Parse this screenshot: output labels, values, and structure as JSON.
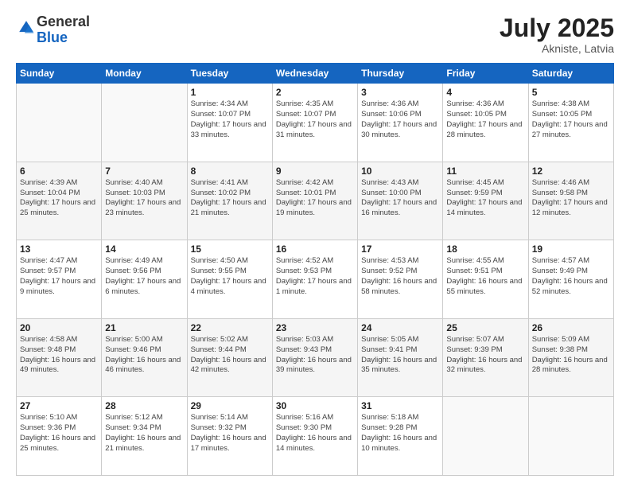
{
  "header": {
    "logo_general": "General",
    "logo_blue": "Blue",
    "month": "July 2025",
    "location": "Akniste, Latvia"
  },
  "days_of_week": [
    "Sunday",
    "Monday",
    "Tuesday",
    "Wednesday",
    "Thursday",
    "Friday",
    "Saturday"
  ],
  "weeks": [
    [
      {
        "day": "",
        "info": ""
      },
      {
        "day": "",
        "info": ""
      },
      {
        "day": "1",
        "info": "Sunrise: 4:34 AM\nSunset: 10:07 PM\nDaylight: 17 hours and 33 minutes."
      },
      {
        "day": "2",
        "info": "Sunrise: 4:35 AM\nSunset: 10:07 PM\nDaylight: 17 hours and 31 minutes."
      },
      {
        "day": "3",
        "info": "Sunrise: 4:36 AM\nSunset: 10:06 PM\nDaylight: 17 hours and 30 minutes."
      },
      {
        "day": "4",
        "info": "Sunrise: 4:36 AM\nSunset: 10:05 PM\nDaylight: 17 hours and 28 minutes."
      },
      {
        "day": "5",
        "info": "Sunrise: 4:38 AM\nSunset: 10:05 PM\nDaylight: 17 hours and 27 minutes."
      }
    ],
    [
      {
        "day": "6",
        "info": "Sunrise: 4:39 AM\nSunset: 10:04 PM\nDaylight: 17 hours and 25 minutes."
      },
      {
        "day": "7",
        "info": "Sunrise: 4:40 AM\nSunset: 10:03 PM\nDaylight: 17 hours and 23 minutes."
      },
      {
        "day": "8",
        "info": "Sunrise: 4:41 AM\nSunset: 10:02 PM\nDaylight: 17 hours and 21 minutes."
      },
      {
        "day": "9",
        "info": "Sunrise: 4:42 AM\nSunset: 10:01 PM\nDaylight: 17 hours and 19 minutes."
      },
      {
        "day": "10",
        "info": "Sunrise: 4:43 AM\nSunset: 10:00 PM\nDaylight: 17 hours and 16 minutes."
      },
      {
        "day": "11",
        "info": "Sunrise: 4:45 AM\nSunset: 9:59 PM\nDaylight: 17 hours and 14 minutes."
      },
      {
        "day": "12",
        "info": "Sunrise: 4:46 AM\nSunset: 9:58 PM\nDaylight: 17 hours and 12 minutes."
      }
    ],
    [
      {
        "day": "13",
        "info": "Sunrise: 4:47 AM\nSunset: 9:57 PM\nDaylight: 17 hours and 9 minutes."
      },
      {
        "day": "14",
        "info": "Sunrise: 4:49 AM\nSunset: 9:56 PM\nDaylight: 17 hours and 6 minutes."
      },
      {
        "day": "15",
        "info": "Sunrise: 4:50 AM\nSunset: 9:55 PM\nDaylight: 17 hours and 4 minutes."
      },
      {
        "day": "16",
        "info": "Sunrise: 4:52 AM\nSunset: 9:53 PM\nDaylight: 17 hours and 1 minute."
      },
      {
        "day": "17",
        "info": "Sunrise: 4:53 AM\nSunset: 9:52 PM\nDaylight: 16 hours and 58 minutes."
      },
      {
        "day": "18",
        "info": "Sunrise: 4:55 AM\nSunset: 9:51 PM\nDaylight: 16 hours and 55 minutes."
      },
      {
        "day": "19",
        "info": "Sunrise: 4:57 AM\nSunset: 9:49 PM\nDaylight: 16 hours and 52 minutes."
      }
    ],
    [
      {
        "day": "20",
        "info": "Sunrise: 4:58 AM\nSunset: 9:48 PM\nDaylight: 16 hours and 49 minutes."
      },
      {
        "day": "21",
        "info": "Sunrise: 5:00 AM\nSunset: 9:46 PM\nDaylight: 16 hours and 46 minutes."
      },
      {
        "day": "22",
        "info": "Sunrise: 5:02 AM\nSunset: 9:44 PM\nDaylight: 16 hours and 42 minutes."
      },
      {
        "day": "23",
        "info": "Sunrise: 5:03 AM\nSunset: 9:43 PM\nDaylight: 16 hours and 39 minutes."
      },
      {
        "day": "24",
        "info": "Sunrise: 5:05 AM\nSunset: 9:41 PM\nDaylight: 16 hours and 35 minutes."
      },
      {
        "day": "25",
        "info": "Sunrise: 5:07 AM\nSunset: 9:39 PM\nDaylight: 16 hours and 32 minutes."
      },
      {
        "day": "26",
        "info": "Sunrise: 5:09 AM\nSunset: 9:38 PM\nDaylight: 16 hours and 28 minutes."
      }
    ],
    [
      {
        "day": "27",
        "info": "Sunrise: 5:10 AM\nSunset: 9:36 PM\nDaylight: 16 hours and 25 minutes."
      },
      {
        "day": "28",
        "info": "Sunrise: 5:12 AM\nSunset: 9:34 PM\nDaylight: 16 hours and 21 minutes."
      },
      {
        "day": "29",
        "info": "Sunrise: 5:14 AM\nSunset: 9:32 PM\nDaylight: 16 hours and 17 minutes."
      },
      {
        "day": "30",
        "info": "Sunrise: 5:16 AM\nSunset: 9:30 PM\nDaylight: 16 hours and 14 minutes."
      },
      {
        "day": "31",
        "info": "Sunrise: 5:18 AM\nSunset: 9:28 PM\nDaylight: 16 hours and 10 minutes."
      },
      {
        "day": "",
        "info": ""
      },
      {
        "day": "",
        "info": ""
      }
    ]
  ]
}
